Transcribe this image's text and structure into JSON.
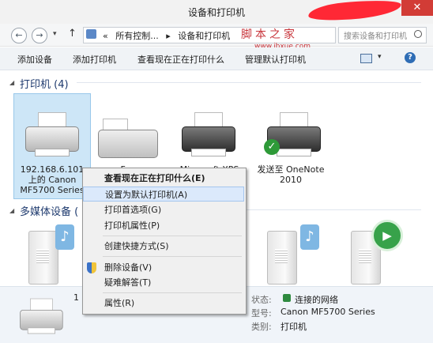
{
  "window": {
    "title": "设备和打印机",
    "close_glyph": "✕"
  },
  "nav": {
    "back_glyph": "←",
    "forward_glyph": "→",
    "dropdown_glyph": "▾",
    "up_glyph": "↑",
    "address_prefix": "«",
    "address_parts": [
      "所有控制...",
      "▸",
      "设备和打印机"
    ],
    "search_placeholder": "搜索设备和打印机",
    "watermark": "脚本之家",
    "watermark_url": "www.jbxue.com"
  },
  "commands": [
    "添加设备",
    "添加打印机",
    "查看现在正在打印什么",
    "管理默认打印机"
  ],
  "view_chevron": "▾",
  "help_glyph": "?",
  "groups": {
    "printers": {
      "label": "打印机 (4)",
      "chevron": "◢"
    },
    "multimedia": {
      "label": "多媒体设备 (",
      "chevron": "◢"
    }
  },
  "printers": [
    {
      "label_lines": [
        "192.168.6.101",
        "上的 Canon",
        "MF5700 Series"
      ],
      "selected": true
    },
    {
      "label_lines": [
        "F..."
      ]
    },
    {
      "label_lines": [
        "Microsoft XPS"
      ]
    },
    {
      "label_lines": [
        "发送至 OneNote",
        "2010"
      ],
      "default": true
    }
  ],
  "context_menu": [
    {
      "label": "查看现在正在打印什么(E)",
      "bold": true
    },
    {
      "label": "设置为默认打印机(A)",
      "highlighted": true
    },
    {
      "label": "打印首选项(G)"
    },
    {
      "label": "打印机属性(P)"
    },
    {
      "separator": true
    },
    {
      "label": "创建快捷方式(S)"
    },
    {
      "separator": true
    },
    {
      "label": "删除设备(V)",
      "icon": "shield-icon"
    },
    {
      "label": "疑难解答(T)"
    },
    {
      "separator": true
    },
    {
      "label": "属性(R)"
    }
  ],
  "details": {
    "obscured_prefix": "1",
    "status_label": "状态:",
    "status_value": "连接的网络",
    "model_label": "型号:",
    "model_value": "Canon MF5700 Series",
    "category_label": "类别:",
    "category_value": "打印机"
  },
  "colors": {
    "accent": "#1e3a6e",
    "selection": "#cde6f7",
    "close": "#d23c36",
    "default_check": "#2e9a38"
  }
}
